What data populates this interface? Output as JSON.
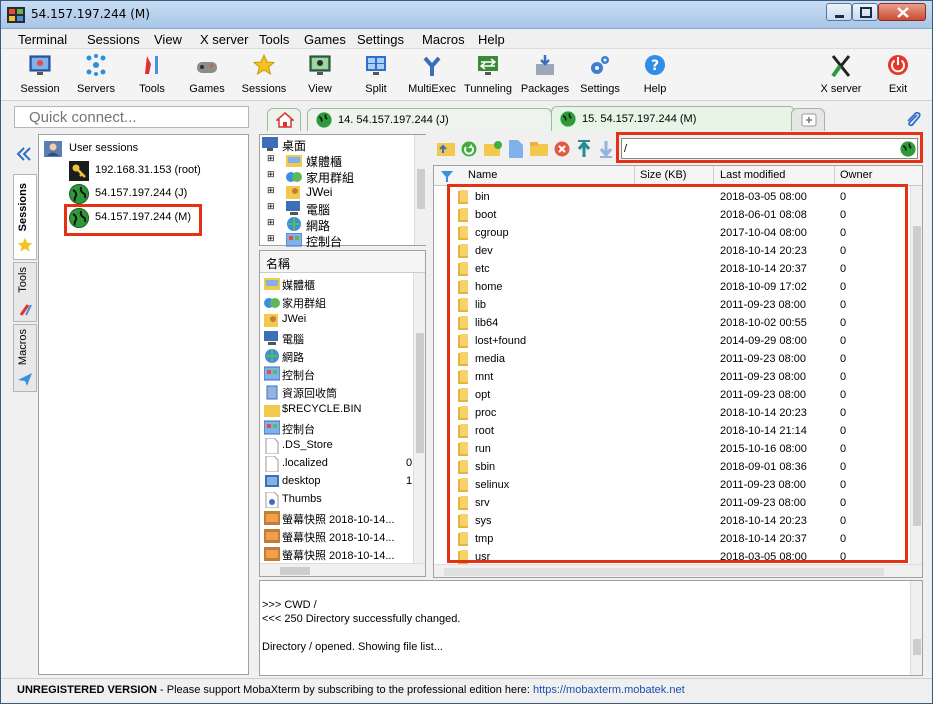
{
  "window": {
    "title": "54.157.197.244 (M)"
  },
  "menu": [
    "Terminal",
    "Sessions",
    "View",
    "X server",
    "Tools",
    "Games",
    "Settings",
    "Macros",
    "Help"
  ],
  "toolbar": [
    {
      "label": "Session",
      "icon": "session-icon"
    },
    {
      "label": "Servers",
      "icon": "servers-icon"
    },
    {
      "label": "Tools",
      "icon": "tools-icon"
    },
    {
      "label": "Games",
      "icon": "games-icon"
    },
    {
      "label": "Sessions",
      "icon": "star-icon"
    },
    {
      "label": "View",
      "icon": "view-icon"
    },
    {
      "label": "Split",
      "icon": "split-icon"
    },
    {
      "label": "MultiExec",
      "icon": "multiexec-icon"
    },
    {
      "label": "Tunneling",
      "icon": "tunneling-icon"
    },
    {
      "label": "Packages",
      "icon": "packages-icon"
    },
    {
      "label": "Settings",
      "icon": "settings-icon"
    },
    {
      "label": "Help",
      "icon": "help-icon"
    },
    {
      "label": "X server",
      "icon": "xserver-icon"
    },
    {
      "label": "Exit",
      "icon": "power-icon"
    }
  ],
  "quick_connect": {
    "placeholder": "Quick connect..."
  },
  "side_tabs": [
    "Sessions",
    "Tools",
    "Macros"
  ],
  "sessions": {
    "root_label": "User sessions",
    "items": [
      {
        "label": "192.168.31.153 (root)",
        "icon": "key-icon"
      },
      {
        "label": "54.157.197.244 (J)",
        "icon": "globe-icon"
      },
      {
        "label": "54.157.197.244 (M)",
        "icon": "globe-icon"
      }
    ]
  },
  "tabs": [
    {
      "label": "14. 54.157.197.244 (J)"
    },
    {
      "label": "15. 54.157.197.244 (M)"
    }
  ],
  "tree": {
    "root": "桌面",
    "items": [
      "媒體櫃",
      "家用群組",
      "JWei",
      "電腦",
      "網路",
      "控制台"
    ]
  },
  "local_list": {
    "header": "名稱",
    "items": [
      "媒體櫃",
      "家用群組",
      "JWei",
      "電腦",
      "網路",
      "控制台",
      "資源回收筒",
      "$RECYCLE.BIN",
      "控制台",
      ".DS_Store",
      ".localized",
      "desktop",
      "Thumbs",
      "螢幕快照 2018-10-14...",
      "螢幕快照 2018-10-14...",
      "螢幕快照 2018-10-14..."
    ],
    "trailing": {
      "10": "0",
      "11": "1"
    }
  },
  "sftp": {
    "path": "/",
    "columns": [
      "Name",
      "Size (KB)",
      "Last modified",
      "Owner"
    ],
    "files": [
      {
        "name": "bin",
        "modified": "2018-03-05 08:00",
        "owner": "0"
      },
      {
        "name": "boot",
        "modified": "2018-06-01 08:08",
        "owner": "0"
      },
      {
        "name": "cgroup",
        "modified": "2017-10-04 08:00",
        "owner": "0"
      },
      {
        "name": "dev",
        "modified": "2018-10-14 20:23",
        "owner": "0"
      },
      {
        "name": "etc",
        "modified": "2018-10-14 20:37",
        "owner": "0"
      },
      {
        "name": "home",
        "modified": "2018-10-09 17:02",
        "owner": "0"
      },
      {
        "name": "lib",
        "modified": "2011-09-23 08:00",
        "owner": "0"
      },
      {
        "name": "lib64",
        "modified": "2018-10-02 00:55",
        "owner": "0"
      },
      {
        "name": "lost+found",
        "modified": "2014-09-29 08:00",
        "owner": "0"
      },
      {
        "name": "media",
        "modified": "2011-09-23 08:00",
        "owner": "0"
      },
      {
        "name": "mnt",
        "modified": "2011-09-23 08:00",
        "owner": "0"
      },
      {
        "name": "opt",
        "modified": "2011-09-23 08:00",
        "owner": "0"
      },
      {
        "name": "proc",
        "modified": "2018-10-14 20:23",
        "owner": "0"
      },
      {
        "name": "root",
        "modified": "2018-10-14 21:14",
        "owner": "0"
      },
      {
        "name": "run",
        "modified": "2015-10-16 08:00",
        "owner": "0"
      },
      {
        "name": "sbin",
        "modified": "2018-09-01 08:36",
        "owner": "0"
      },
      {
        "name": "selinux",
        "modified": "2011-09-23 08:00",
        "owner": "0"
      },
      {
        "name": "srv",
        "modified": "2011-09-23 08:00",
        "owner": "0"
      },
      {
        "name": "sys",
        "modified": "2018-10-14 20:23",
        "owner": "0"
      },
      {
        "name": "tmp",
        "modified": "2018-10-14 20:37",
        "owner": "0"
      },
      {
        "name": "usr",
        "modified": "2018-03-05 08:00",
        "owner": "0"
      }
    ]
  },
  "log": [
    ">>>  CWD /",
    "<<<  250 Directory successfully changed.",
    "",
    "Directory / opened. Showing file list..."
  ],
  "status": {
    "unregistered": "UNREGISTERED VERSION",
    "message": "  -  Please support MobaXterm by subscribing to the professional edition here:  ",
    "link": "https://mobaxterm.mobatek.net"
  },
  "colors": {
    "highlight": "#e53217",
    "accent": "#1a4fb5",
    "tab_active": "#e6f5e6"
  }
}
